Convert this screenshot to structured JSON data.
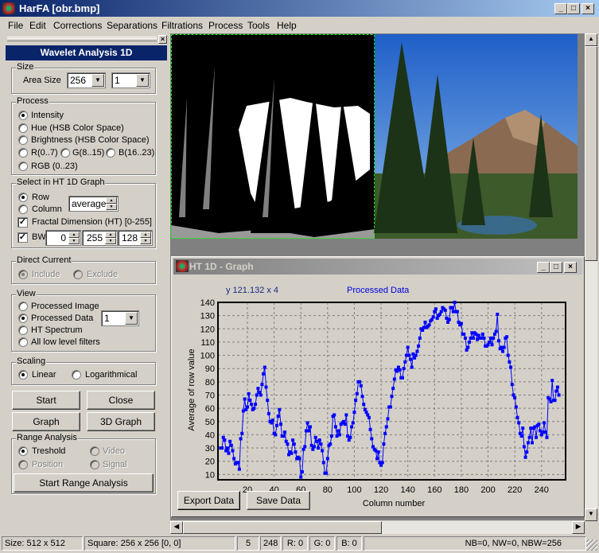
{
  "window": {
    "title": "HarFA [obr.bmp]"
  },
  "menu": [
    "File",
    "Edit",
    "Corrections",
    "Separations",
    "Filtrations",
    "Process",
    "Tools",
    "Help"
  ],
  "panel": {
    "title": "Wavelet Analysis 1D",
    "size": {
      "label": "Size",
      "area_label": "Area Size",
      "area_value": "256",
      "second_value": "1"
    },
    "process": {
      "label": "Process",
      "options": [
        "Intensity",
        "Hue (HSB Color Space)",
        "Brightness (HSB Color Space)",
        "R(0..7)",
        "G(8..15)",
        "B(16..23)",
        "RGB (0..23)"
      ],
      "selected": "Intensity"
    },
    "select": {
      "label": "Select in HT 1D Graph",
      "row": "Row",
      "column": "Column",
      "selected": "Row",
      "mode": "average",
      "fractal_label": "Fractal Dimension (HT) [0-255]",
      "fractal_checked": true,
      "bw_label": "BW",
      "bw_checked": true,
      "bw_values": [
        "0",
        "255",
        "128"
      ]
    },
    "direct_current": {
      "label": "Direct Current",
      "include": "Include",
      "exclude": "Exclude",
      "selected": "Include",
      "disabled": true
    },
    "view": {
      "label": "View",
      "options": [
        "Processed Image",
        "Processed Data",
        "HT Spectrum",
        "All low level filters"
      ],
      "selected": "Processed Data",
      "combo_value": "1"
    },
    "scaling": {
      "label": "Scaling",
      "linear": "Linear",
      "log": "Logarithmical",
      "selected": "Linear"
    },
    "buttons": {
      "start": "Start",
      "close": "Close",
      "graph": "Graph",
      "graph3d": "3D Graph"
    },
    "range": {
      "label": "Range Analysis",
      "treshold": "Treshold",
      "video": "Video",
      "position": "Position",
      "signal": "Signal",
      "selected": "Treshold",
      "start": "Start Range Analysis"
    }
  },
  "graph_window": {
    "title": "HT 1D - Graph",
    "cursor_readout": "y 121.132 x 4",
    "series_title": "Processed Data",
    "export": "Export Data",
    "save": "Save Data"
  },
  "chart_data": {
    "type": "line",
    "title": "Processed Data",
    "xlabel": "Column number",
    "ylabel": "Average of row value",
    "xlim": [
      -2,
      258
    ],
    "ylim": [
      6,
      140
    ],
    "grid": true,
    "color": "#0000ff",
    "marker": "square",
    "xticks": [
      20,
      40,
      60,
      80,
      100,
      120,
      140,
      160,
      180,
      200,
      220,
      240
    ],
    "yticks": [
      10,
      20,
      30,
      40,
      50,
      60,
      70,
      80,
      90,
      100,
      110,
      120,
      130,
      140
    ],
    "y": [
      30,
      30,
      38,
      36,
      28,
      30,
      26,
      35,
      32,
      28,
      22,
      18,
      19,
      19,
      14,
      37,
      41,
      58,
      67,
      59,
      61,
      71,
      66,
      63,
      59,
      60,
      63,
      70,
      75,
      72,
      70,
      78,
      86,
      91,
      76,
      66,
      56,
      50,
      49,
      51,
      41,
      40,
      47,
      54,
      59,
      48,
      39,
      39,
      42,
      35,
      33,
      25,
      27,
      26,
      36,
      33,
      27,
      22,
      23,
      22,
      8,
      12,
      29,
      31,
      43,
      49,
      43,
      46,
      32,
      29,
      31,
      38,
      35,
      30,
      36,
      33,
      28,
      19,
      11,
      11,
      22,
      32,
      33,
      39,
      54,
      55,
      46,
      39,
      43,
      40,
      48,
      49,
      50,
      48,
      55,
      39,
      36,
      38,
      46,
      49,
      57,
      66,
      71,
      80,
      80,
      77,
      69,
      63,
      59,
      57,
      55,
      53,
      44,
      37,
      31,
      29,
      28,
      22,
      27,
      19,
      17,
      19,
      33,
      41,
      46,
      52,
      61,
      61,
      69,
      75,
      82,
      89,
      88,
      91,
      89,
      83,
      83,
      90,
      95,
      100,
      106,
      100,
      97,
      91,
      101,
      98,
      100,
      103,
      107,
      113,
      120,
      119,
      121,
      125,
      121,
      122,
      123,
      126,
      127,
      129,
      133,
      135,
      128,
      130,
      131,
      133,
      136,
      135,
      134,
      128,
      125,
      127,
      136,
      136,
      133,
      140,
      133,
      133,
      125,
      123,
      124,
      116,
      116,
      113,
      104,
      106,
      110,
      113,
      117,
      113,
      117,
      116,
      112,
      115,
      113,
      113,
      116,
      113,
      107,
      107,
      108,
      110,
      113,
      108,
      113,
      116,
      118,
      131,
      111,
      105,
      106,
      103,
      106,
      113,
      114,
      100,
      95,
      91,
      78,
      70,
      68,
      61,
      53,
      49,
      41,
      39,
      45,
      31,
      23,
      27,
      34,
      38,
      45,
      34,
      45,
      46,
      38,
      47,
      48,
      43,
      40,
      42,
      49,
      42,
      38,
      68,
      67,
      65,
      81,
      66,
      66,
      73,
      76,
      70
    ]
  },
  "status": {
    "size": "Size: 512 x 512",
    "square": "Square: 256 x 256 [0, 0]",
    "v1": "5",
    "v2": "248",
    "r": "R: 0",
    "g": "G: 0",
    "b": "B: 0",
    "nb": "NB=0, NW=0, NBW=256"
  }
}
